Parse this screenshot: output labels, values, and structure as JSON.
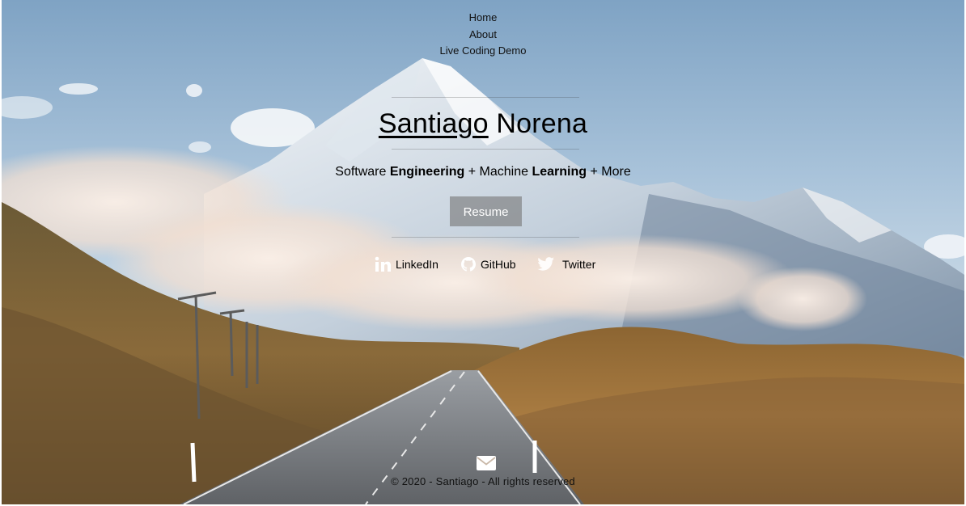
{
  "nav": {
    "items": [
      {
        "label": "Home"
      },
      {
        "label": "About"
      },
      {
        "label": "Live Coding Demo"
      }
    ]
  },
  "hero": {
    "first_name": "Santiago",
    "last_name": "Norena",
    "tagline": {
      "part1": "Software ",
      "bold1": "Engineering",
      "part2": " + Machine ",
      "bold2": "Learning",
      "part3": " + More"
    },
    "resume_label": "Resume",
    "background": "mountain-road-photo"
  },
  "social": {
    "items": [
      {
        "label": "LinkedIn",
        "icon": "linkedin-icon"
      },
      {
        "label": "GitHub",
        "icon": "github-icon"
      },
      {
        "label": "Twitter",
        "icon": "twitter-icon"
      }
    ]
  },
  "footer": {
    "mail_icon": "envelope-icon",
    "copyright": "© 2020 - Santiago - All rights reserved"
  },
  "colors": {
    "text": "#000000",
    "button_bg": "#787878",
    "button_text": "#ffffff"
  }
}
